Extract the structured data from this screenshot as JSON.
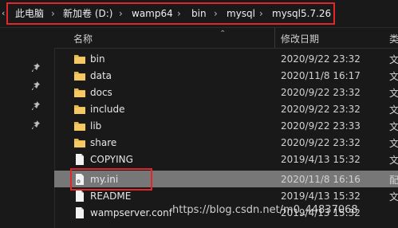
{
  "breadcrumb": {
    "items": [
      "此电脑",
      "新加卷 (D:)",
      "wamp64",
      "bin",
      "mysql",
      "mysql5.7.26"
    ],
    "separator": "›"
  },
  "columns": {
    "name": "名称",
    "date": "修改日期",
    "more": "类"
  },
  "rows": [
    {
      "name": "bin",
      "date": "2020/9/22 23:32",
      "type": "folder",
      "clip": "文"
    },
    {
      "name": "data",
      "date": "2020/11/8 16:17",
      "type": "folder",
      "clip": "文"
    },
    {
      "name": "docs",
      "date": "2020/9/22 23:32",
      "type": "folder",
      "clip": "文"
    },
    {
      "name": "include",
      "date": "2020/9/22 23:32",
      "type": "folder",
      "clip": "文"
    },
    {
      "name": "lib",
      "date": "2020/9/22 23:33",
      "type": "folder",
      "clip": "文"
    },
    {
      "name": "share",
      "date": "2020/9/22 23:32",
      "type": "folder",
      "clip": "文"
    },
    {
      "name": "COPYING",
      "date": "2019/4/13 15:32",
      "type": "file",
      "clip": "文"
    },
    {
      "name": "my.ini",
      "date": "2020/11/8 16:16",
      "type": "config",
      "selected": true,
      "clip": "配"
    },
    {
      "name": "README",
      "date": "2019/4/13 15:32",
      "type": "file",
      "clip": "文"
    },
    {
      "name": "wampserver.conf",
      "date": "2019/4/13 15:32",
      "type": "file",
      "clip": ""
    }
  ],
  "watermark": "https://blog.csdn.net/m0_44837068",
  "colors": {
    "background": "#191919",
    "highlight": "#e3262a",
    "selected_row": "#777777",
    "folder": "#e8b84a"
  },
  "icons": {
    "folder": "folder-icon",
    "file": "file-icon",
    "config": "settings-file-icon",
    "pin": "pin-icon"
  }
}
